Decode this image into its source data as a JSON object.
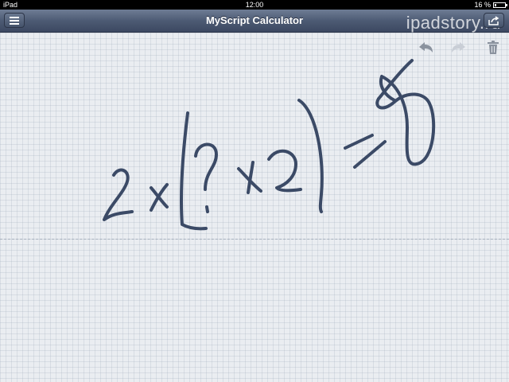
{
  "statusbar": {
    "device": "iPad",
    "time": "12:00",
    "battery_text": "16 %",
    "battery_level": 0.16
  },
  "navbar": {
    "title": "MyScript Calculator",
    "watermark": "ipadstory.ru"
  },
  "toolbar": {
    "undo_icon": "undo-arrow-icon",
    "redo_icon": "redo-arrow-icon",
    "delete_icon": "trash-icon"
  },
  "colors": {
    "ink": "#3b4a66",
    "nav": "#4d5b74"
  }
}
